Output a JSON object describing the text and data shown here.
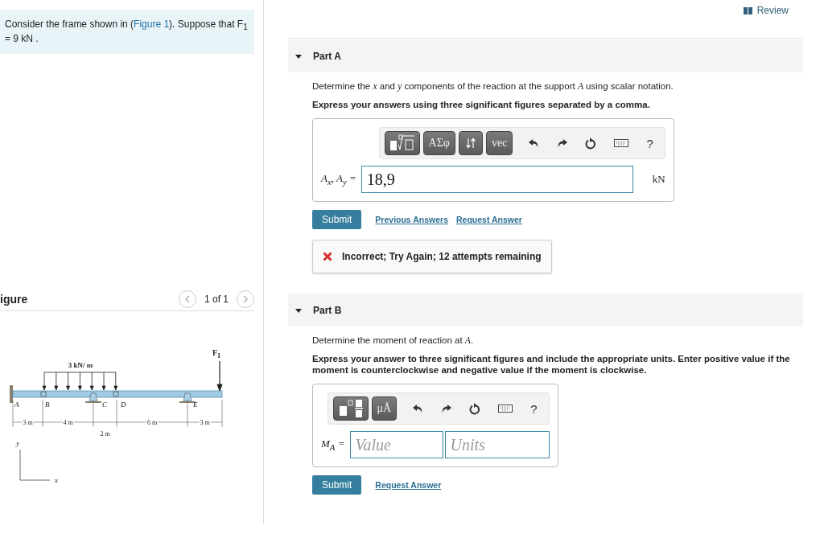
{
  "problem": {
    "before": "Consider the frame shown in (",
    "link": "Figure 1",
    "after": "). Suppose that F$_{1}$ = 9 kN ."
  },
  "figure": {
    "title": "igure",
    "pager": "1 of 1",
    "load": "3 kN/ m",
    "force": "F$_{1}$",
    "points": [
      "A",
      "B",
      "C",
      "D",
      "E"
    ],
    "dims": [
      "3 m",
      "4 m",
      "2 m",
      "6 m",
      "3 m"
    ],
    "axes": [
      "y",
      "x"
    ]
  },
  "review": "Review",
  "parts": [
    {
      "title": "Part A",
      "expanded": true,
      "prompt": "Determine the *x* and *y* components of the reaction at the support *A* using scalar notation.",
      "instruction": "Express your answers using three significant figures separated by a comma.",
      "tools": [
        {
          "kind": "templates"
        },
        {
          "kind": "text",
          "label": "ΑΣφ"
        },
        {
          "kind": "arrows"
        },
        {
          "kind": "text",
          "label": "vec"
        }
      ],
      "help": "?",
      "answer_label": "A$_{x}$, A$_{y}$ =",
      "fields": [
        {
          "kind": "value",
          "value": "18,9"
        }
      ],
      "unit": "kN",
      "submit": "Submit",
      "links": [
        "Previous Answers",
        "Request Answer"
      ],
      "feedback": {
        "kind": "incorrect",
        "text": "Incorrect; Try Again; 12 attempts remaining"
      }
    },
    {
      "title": "Part B",
      "expanded": true,
      "prompt": "Determine the moment of reaction at *A*.",
      "instruction": "Express your answer to three significant figures and include the appropriate units. Enter positive value if the moment is counterclockwise and negative value if the moment is clockwise.",
      "tools": [
        {
          "kind": "fraction"
        },
        {
          "kind": "text",
          "label": "μÅ"
        }
      ],
      "help": "?",
      "answer_label": "M$_{A}$ =",
      "fields": [
        {
          "kind": "value",
          "placeholder": "Value"
        },
        {
          "kind": "units",
          "placeholder": "Units"
        }
      ],
      "submit": "Submit",
      "links": [
        "Request Answer"
      ]
    }
  ]
}
